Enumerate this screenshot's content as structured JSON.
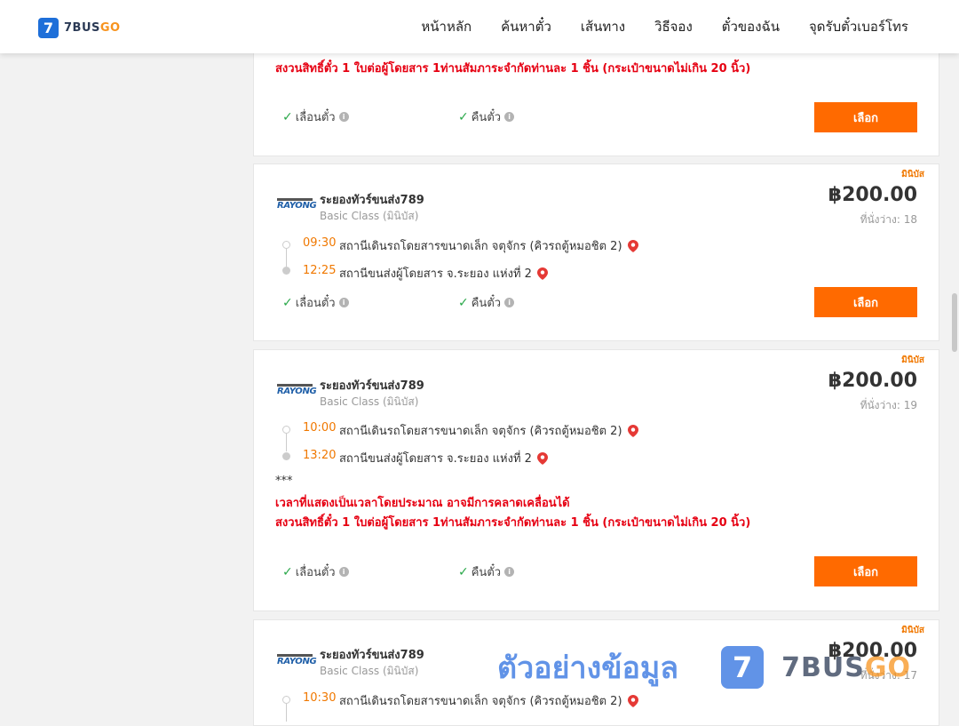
{
  "header": {
    "logo_badge": "7",
    "logo_text_a": "7BUS",
    "logo_text_b": "GO",
    "nav": [
      "หน้าหลัก",
      "ค้นหาตั๋ว",
      "เส้นทาง",
      "วิธีจอง",
      "ตั๋วของฉัน",
      "จุดรับตั๋วเบอร์โทร"
    ]
  },
  "labels": {
    "reschedule": "เลื่อนตั๋ว",
    "refund": "คืนตั๋ว",
    "select": "เลือก",
    "type_tag": "มินิบัส",
    "seats_prefix": "ที่นั่งว่าง: "
  },
  "card0": {
    "notice": "สงวนสิทธิ์ตั๋ว 1 ใบต่อผู้โดยสาร 1ท่านสัมภาระจำกัดท่านละ 1 ชิ้น (กระเป๋าขนาดไม่เกิน 20 นิ้ว)"
  },
  "trips": [
    {
      "operator_logo": "RAYONG",
      "operator": "ระยองทัวร์ขนส่ง789",
      "class": "Basic Class (มินิบัส)",
      "price": "฿200.00",
      "seats": "ที่นั่งว่าง: 18",
      "depart_time": "09:30",
      "depart_station": "สถานีเดินรถโดยสารขนาดเล็ก จตุจักร (คิวรถตู้หมอชิต 2)",
      "arrive_time": "12:25",
      "arrive_station": "สถานีขนส่งผู้โดยสาร จ.ระยอง แห่งที่ 2"
    },
    {
      "operator_logo": "RAYONG",
      "operator": "ระยองทัวร์ขนส่ง789",
      "class": "Basic Class (มินิบัส)",
      "price": "฿200.00",
      "seats": "ที่นั่งว่าง: 19",
      "depart_time": "10:00",
      "depart_station": "สถานีเดินรถโดยสารขนาดเล็ก จตุจักร (คิวรถตู้หมอชิต 2)",
      "arrive_time": "13:20",
      "arrive_station": "สถานีขนส่งผู้โดยสาร จ.ระยอง แห่งที่ 2",
      "stars": "***",
      "notice1": "เวลาที่แสดงเป็นเวลาโดยประมาณ อาจมีการคลาดเคลื่อนได้",
      "notice2": "สงวนสิทธิ์ตั๋ว 1 ใบต่อผู้โดยสาร 1ท่านสัมภาระจำกัดท่านละ 1 ชิ้น (กระเป๋าขนาดไม่เกิน 20 นิ้ว)"
    },
    {
      "operator_logo": "RAYONG",
      "operator": "ระยองทัวร์ขนส่ง789",
      "class": "Basic Class (มินิบัส)",
      "price": "฿200.00",
      "seats": "ที่นั่งว่าง: 17",
      "depart_time": "10:30",
      "depart_station": "สถานีเดินรถโดยสารขนาดเล็ก จตุจักร (คิวรถตู้หมอชิต 2)"
    }
  ],
  "watermark": {
    "text": "ตัวอย่างข้อมูล",
    "badge": "7",
    "brand_a": "7BUS",
    "brand_b": "GO"
  },
  "colors": {
    "accent": "#ff6a00",
    "time": "#f07800",
    "notice": "#e60012",
    "brand_blue": "#1e6fd9"
  }
}
